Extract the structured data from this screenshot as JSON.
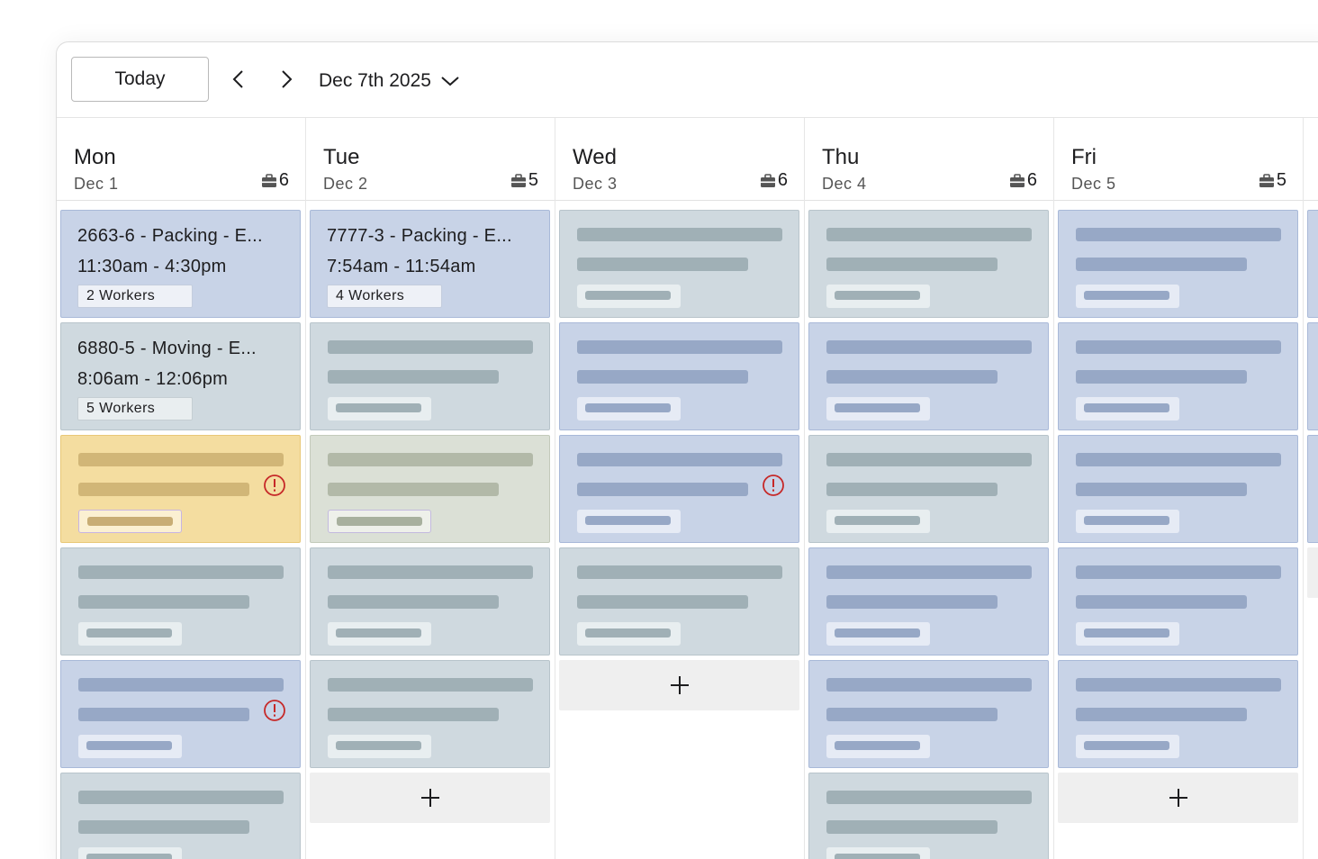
{
  "toolbar": {
    "today_label": "Today",
    "prev_icon": "chevron-left-icon",
    "next_icon": "chevron-right-icon",
    "date_label": "Dec 7th 2025",
    "dropdown_icon": "chevron-down-icon"
  },
  "days": [
    {
      "name": "Mon",
      "date": "Dec 1",
      "crew_count": "6",
      "cards": [
        {
          "color": "blue",
          "title": "2663-6 - Packing - E...",
          "time": "11:30am - 4:30pm",
          "workers": "2 Workers"
        },
        {
          "color": "gray",
          "title": "6880-5 - Moving - E...",
          "time": "8:06am - 12:06pm",
          "workers": "5 Workers"
        },
        {
          "color": "yellow",
          "alert": true
        },
        {
          "color": "gray"
        },
        {
          "color": "blue",
          "alert": true
        },
        {
          "color": "gray"
        }
      ],
      "add_slot": false
    },
    {
      "name": "Tue",
      "date": "Dec 2",
      "crew_count": "5",
      "cards": [
        {
          "color": "blue",
          "title": "7777-3 - Packing - E...",
          "time": "7:54am - 11:54am",
          "workers": "4 Workers"
        },
        {
          "color": "gray"
        },
        {
          "color": "sage"
        },
        {
          "color": "gray"
        },
        {
          "color": "gray"
        }
      ],
      "add_slot": true
    },
    {
      "name": "Wed",
      "date": "Dec 3",
      "crew_count": "6",
      "cards": [
        {
          "color": "gray"
        },
        {
          "color": "blue"
        },
        {
          "color": "blue",
          "alert": true
        },
        {
          "color": "gray"
        }
      ],
      "add_slot": true
    },
    {
      "name": "Thu",
      "date": "Dec 4",
      "crew_count": "6",
      "cards": [
        {
          "color": "gray"
        },
        {
          "color": "blue"
        },
        {
          "color": "gray"
        },
        {
          "color": "blue"
        },
        {
          "color": "blue"
        },
        {
          "color": "gray"
        }
      ],
      "add_slot": false
    },
    {
      "name": "Fri",
      "date": "Dec 5",
      "crew_count": "5",
      "cards": [
        {
          "color": "blue"
        },
        {
          "color": "blue"
        },
        {
          "color": "blue"
        },
        {
          "color": "blue"
        },
        {
          "color": "blue"
        }
      ],
      "add_slot": true
    }
  ],
  "icons": {
    "crew": "toolbox-icon",
    "alert": "alert-circle-icon",
    "add": "plus-icon"
  },
  "colors": {
    "card_blue": "#c8d3e7",
    "card_gray": "#cfd9df",
    "card_yellow": "#f4dda0",
    "card_sage": "#dbe0d6",
    "alert": "#c62828"
  }
}
